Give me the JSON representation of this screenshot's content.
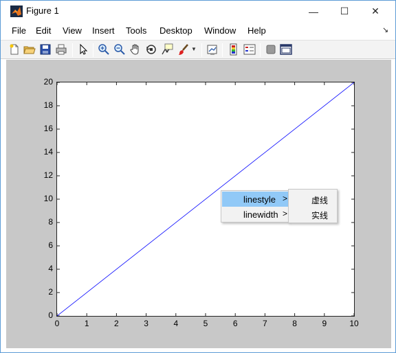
{
  "window": {
    "title": "Figure 1",
    "controls": {
      "minimize": "—",
      "maximize": "☐",
      "close": "✕"
    }
  },
  "menubar": {
    "items": [
      "File",
      "Edit",
      "View",
      "Insert",
      "Tools",
      "Desktop",
      "Window",
      "Help"
    ],
    "dock_icon": "↘"
  },
  "toolbar": {
    "icons": [
      "new-figure-icon",
      "open-file-icon",
      "save-icon",
      "print-icon",
      "edit-plot-icon",
      "zoom-in-icon",
      "zoom-out-icon",
      "pan-icon",
      "rotate-3d-icon",
      "data-cursor-icon",
      "brush-icon",
      "brush-dropdown-icon",
      "link-plot-icon",
      "colorbar-icon",
      "legend-icon",
      "hide-plot-tools-icon",
      "show-plot-tools-icon"
    ]
  },
  "chart_data": {
    "type": "line",
    "title": "",
    "xlabel": "",
    "ylabel": "",
    "xlim": [
      0,
      10
    ],
    "ylim": [
      0,
      20
    ],
    "xticks": [
      "0",
      "1",
      "2",
      "3",
      "4",
      "5",
      "6",
      "7",
      "8",
      "9",
      "10"
    ],
    "yticks": [
      "0",
      "2",
      "4",
      "6",
      "8",
      "10",
      "12",
      "14",
      "16",
      "18",
      "20"
    ],
    "series": [
      {
        "x": [
          0,
          10
        ],
        "y": [
          0,
          20
        ],
        "color": "#0000ff"
      }
    ],
    "grid": false,
    "legend": false
  },
  "context_menu": {
    "items": [
      {
        "label": "linestyle",
        "arrow": ">"
      },
      {
        "label": "linewidth",
        "arrow": ">"
      }
    ],
    "submenu": [
      "虚线",
      "实线"
    ]
  },
  "colors": {
    "figure_bg": "#c8c8c8",
    "highlight": "#91c9f7",
    "line": "#0000ff"
  }
}
